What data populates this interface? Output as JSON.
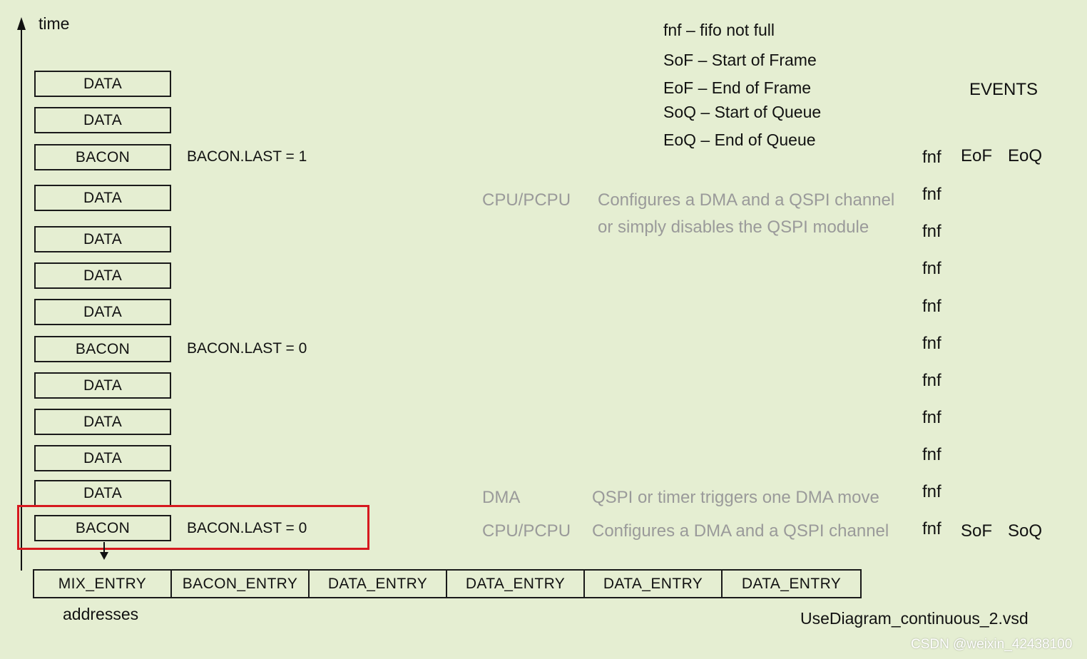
{
  "axis": {
    "time_label": "time",
    "addresses_label": "addresses"
  },
  "stack": [
    {
      "label": "DATA",
      "note": ""
    },
    {
      "label": "DATA",
      "note": ""
    },
    {
      "label": "BACON",
      "note": "BACON.LAST = 1"
    },
    {
      "label": "DATA",
      "note": ""
    },
    {
      "label": "DATA",
      "note": ""
    },
    {
      "label": "DATA",
      "note": ""
    },
    {
      "label": "DATA",
      "note": ""
    },
    {
      "label": "BACON",
      "note": "BACON.LAST = 0"
    },
    {
      "label": "DATA",
      "note": ""
    },
    {
      "label": "DATA",
      "note": ""
    },
    {
      "label": "DATA",
      "note": ""
    },
    {
      "label": "DATA",
      "note": ""
    },
    {
      "label": "BACON",
      "note": "BACON.LAST = 0"
    }
  ],
  "legend": [
    "fnf – fifo not full",
    "SoF – Start of Frame",
    "EoF – End of Frame",
    "SoQ – Start of Queue",
    "EoQ – End of Queue"
  ],
  "events_header": "EVENTS",
  "events": {
    "fnf": [
      "fnf",
      "fnf",
      "fnf",
      "fnf",
      "fnf",
      "fnf",
      "fnf",
      "fnf",
      "fnf",
      "fnf",
      "fnf"
    ],
    "top_extra": [
      "EoF",
      "EoQ"
    ],
    "bottom_extra": [
      "SoF",
      "SoQ"
    ]
  },
  "actions": [
    {
      "actor": "CPU/PCPU",
      "lines": [
        "Configures a DMA and a QSPI channel",
        "or simply disables the QSPI module"
      ]
    },
    {
      "actor": "DMA",
      "lines": [
        "QSPI or timer triggers one DMA move"
      ]
    },
    {
      "actor": "CPU/PCPU",
      "lines": [
        "Configures a DMA and a QSPI channel"
      ]
    }
  ],
  "addresses": [
    "MIX_ENTRY",
    "BACON_ENTRY",
    "DATA_ENTRY",
    "DATA_ENTRY",
    "DATA_ENTRY",
    "DATA_ENTRY"
  ],
  "filename": "UseDiagram_continuous_2.vsd",
  "watermark": "CSDN @weixin_42438100",
  "colors": {
    "background": "#e5eed2",
    "highlight": "#d6191f",
    "muted_text": "#9a9a9a"
  }
}
